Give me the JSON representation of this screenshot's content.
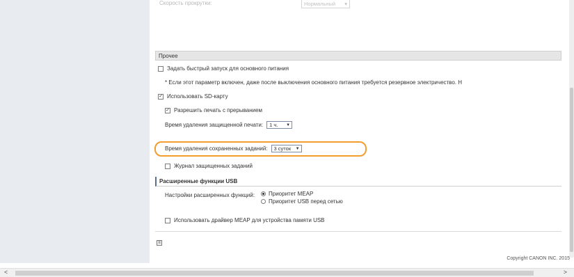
{
  "top": {
    "label": "Скорость прокрутки:",
    "select_value": "Нормальный"
  },
  "other": {
    "title": "Прочее",
    "quick_start": {
      "label": "Задать быстрый запуск для основного питания",
      "checked": false
    },
    "note": "* Если этот параметр включен, даже после выключения основного питания требуется резервное электричество. Н",
    "sd_card": {
      "label": "Использовать SD-карту",
      "checked": true
    },
    "allow_interrupt": {
      "label": "Разрешить печать с прерыванием",
      "checked": true
    },
    "secure_delete": {
      "label": "Время удаления защищенной печати:",
      "value": "1 ч."
    },
    "stored_delete": {
      "label": "Время удаления сохраненных заданий:",
      "value": "3 суток"
    },
    "secure_log": {
      "label": "Журнал защищенных заданий",
      "checked": false
    }
  },
  "usb": {
    "title": "Расширенные функции USB",
    "settings_label": "Настройки расширенных функций:",
    "options": [
      "Приоритет MEAP",
      "Приоритет USB перед сетью"
    ],
    "selected": 0,
    "meap_driver": {
      "label": "Использовать драйвер MEAP для устройства памяти USB",
      "checked": false
    }
  },
  "footer": {
    "copyright": "Copyright CANON INC. 2015"
  },
  "scrollbar": {
    "left": "<",
    "right": ">"
  },
  "colors": {
    "highlight": "#f29d2e",
    "sidebar": "#e8ecf1"
  }
}
